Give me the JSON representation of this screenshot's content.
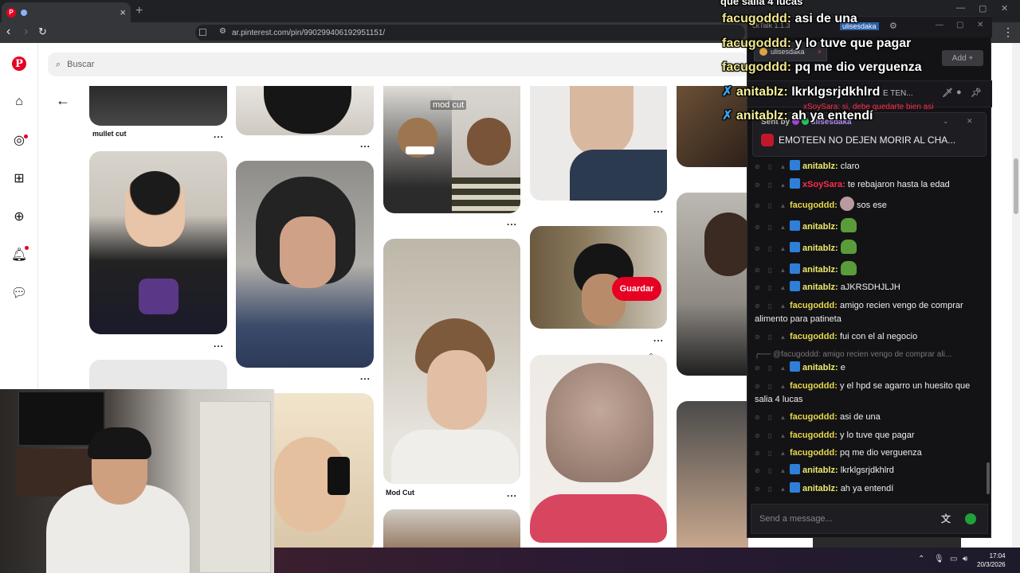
{
  "browser": {
    "url": "ar.pinterest.com/pin/990299406192951151/",
    "new_tab": "+",
    "close_tab": "×"
  },
  "pinterest": {
    "search_placeholder": "Buscar",
    "pins": [
      {
        "label": "mullet cut"
      },
      {
        "label": "Mod Cut"
      },
      {
        "overlay_text": "mod cut"
      }
    ],
    "save_label": "Guardar",
    "more": "..."
  },
  "overlay_chat": [
    {
      "user": "facugoddd",
      "text": "asi de una"
    },
    {
      "user": "facugoddd",
      "text": "y lo tuve que pagar"
    },
    {
      "user": "facugoddd",
      "text": "pq me dio verguenza"
    },
    {
      "user": "anitablz",
      "text": "lkrklgsrjdkhlrd"
    },
    {
      "user": "anitablz",
      "text": "ah ya entendí"
    }
  ],
  "overlay_partial": "que salia 4 lucas",
  "chatterino": {
    "title_user": "ulisesdaka",
    "app_title": "ckTalk 1.1.3",
    "tab_user": "ulisesdaka",
    "add_label": "Add",
    "pinned_banner_text": "E TEN...",
    "pinned": {
      "sent_by": "Sent by",
      "sent_by_user": "ulisesdaka",
      "message": "EMOTEEN NO DEJEN MORIR AL CHA..."
    },
    "partial_top": "xSoySara: si, debe quedarte bien asi",
    "messages": [
      {
        "user": "anitablz",
        "text": "claro"
      },
      {
        "user": "xSoySara",
        "text": "te rebajaron hasta la edad"
      },
      {
        "user": "facugoddd",
        "text": "sos ese"
      },
      {
        "user": "anitablz",
        "text": ""
      },
      {
        "user": "anitablz",
        "text": ""
      },
      {
        "user": "anitablz",
        "text": ""
      },
      {
        "user": "anitablz",
        "text": "aJKRSDHJLJH"
      },
      {
        "user": "facugoddd",
        "text": "amigo recien vengo de comprar alimento para patineta"
      },
      {
        "user": "facugoddd",
        "text": "fui con el al negocio"
      },
      {
        "user": "anitablz",
        "text": "e"
      },
      {
        "user": "facugoddd",
        "text": "y el hpd se agarro un huesito que salia 4 lucas"
      },
      {
        "user": "facugoddd",
        "text": "asi de una"
      },
      {
        "user": "facugoddd",
        "text": "y lo tuve que pagar"
      },
      {
        "user": "facugoddd",
        "text": "pq me dio verguenza"
      },
      {
        "user": "anitablz",
        "text": "lkrklgsrjdkhlrd"
      },
      {
        "user": "anitablz",
        "text": "ah ya entendí"
      }
    ],
    "reply_preview": "@facugoddd: amigo recien vengo de comprar ali...",
    "input_placeholder": "Send a message..."
  },
  "taskbar": {
    "time": "17:04",
    "date": "20/3/2026"
  },
  "colors": {
    "pinterest_red": "#e60023",
    "chat_bg": "#131316",
    "overlay_username": "#f0e68c",
    "overlay_username_blue": "#3aa0e8"
  }
}
